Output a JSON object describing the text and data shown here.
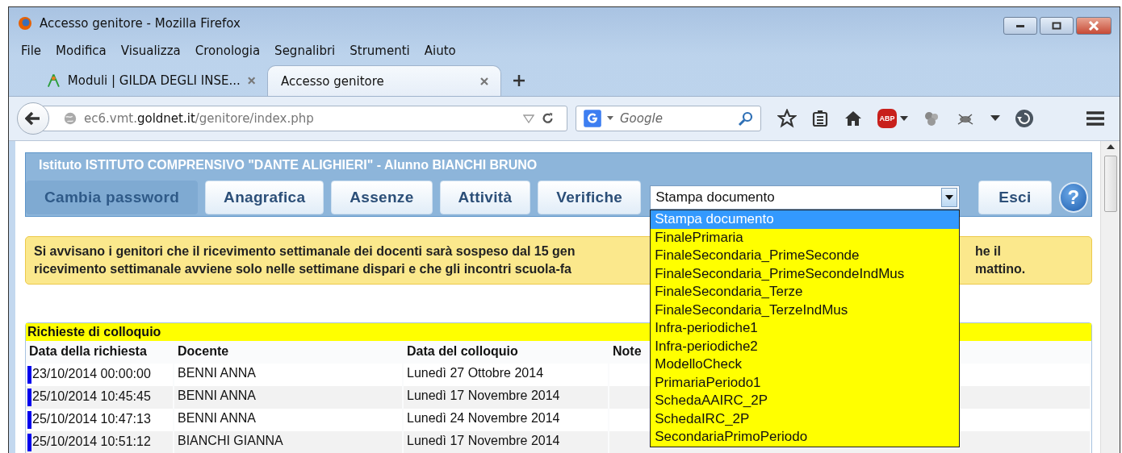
{
  "window": {
    "title": "Accesso genitore - Mozilla Firefox"
  },
  "menu": [
    "File",
    "Modifica",
    "Visualizza",
    "Cronologia",
    "Segnalibri",
    "Strumenti",
    "Aiuto"
  ],
  "tabs": [
    {
      "label": "Moduli | GILDA DEGLI INSE...",
      "selected": false
    },
    {
      "label": "Accesso genitore",
      "selected": true
    }
  ],
  "address": {
    "url": "ec6.vmt.**goldnet.it**/genitore/index.php"
  },
  "search": {
    "placeholder": "Google"
  },
  "toolbar": {
    "adblock_label": "ABP"
  },
  "page": {
    "header": "Istituto ISTITUTO COMPRENSIVO \"DANTE ALIGHIERI\" - Alunno BIANCHI BRUNO",
    "nav": [
      {
        "label": "Cambia password",
        "selected": true
      },
      {
        "label": "Anagrafica",
        "selected": false
      },
      {
        "label": "Assenze",
        "selected": false
      },
      {
        "label": "Attività",
        "selected": false
      },
      {
        "label": "Verifiche",
        "selected": false
      }
    ],
    "select": {
      "value": "Stampa documento",
      "options": [
        {
          "label": "Stampa documento",
          "selected": true
        },
        {
          "label": "FinalePrimaria",
          "selected": false
        },
        {
          "label": "FinaleSecondaria_PrimeSeconde",
          "selected": false
        },
        {
          "label": "FinaleSecondaria_PrimeSecondeIndMus",
          "selected": false
        },
        {
          "label": "FinaleSecondaria_Terze",
          "selected": false
        },
        {
          "label": "FinaleSecondaria_TerzeIndMus",
          "selected": false
        },
        {
          "label": "Infra-periodiche1",
          "selected": false
        },
        {
          "label": "Infra-periodiche2",
          "selected": false
        },
        {
          "label": "ModelloCheck",
          "selected": false
        },
        {
          "label": "PrimariaPeriodo1",
          "selected": false
        },
        {
          "label": "SchedaAAIRC_2P",
          "selected": false
        },
        {
          "label": "SchedaIRC_2P",
          "selected": false
        },
        {
          "label": "SecondariaPrimoPeriodo",
          "selected": false
        }
      ]
    },
    "logout": "Esci",
    "help_label": "?",
    "notice": [
      {
        "left": "Si avvisano i genitori che il ricevimento settimanale dei docenti sarà sospeso dal 15 gen",
        "right": "he il"
      },
      {
        "left": "ricevimento settimanale avviene solo nelle settimane dispari e che gli incontri scuola-fa",
        "right": "mattino."
      }
    ],
    "table": {
      "title": "Richieste di colloquio",
      "columns": [
        "Data della richiesta",
        "Docente",
        "Data del colloquio",
        "Note"
      ],
      "rows": [
        [
          "23/10/2014 00:00:00",
          "BENNI ANNA",
          "Lunedì 27 Ottobre 2014",
          ""
        ],
        [
          "25/10/2014 10:45:45",
          "BENNI ANNA",
          "Lunedì 17 Novembre 2014",
          ""
        ],
        [
          "25/10/2014 10:47:13",
          "BENNI ANNA",
          "Lunedì 24 Novembre 2014",
          ""
        ],
        [
          "25/10/2014 10:51:12",
          "BIANCHI GIANNA",
          "Lunedì 17 Novembre 2014",
          ""
        ]
      ]
    }
  }
}
